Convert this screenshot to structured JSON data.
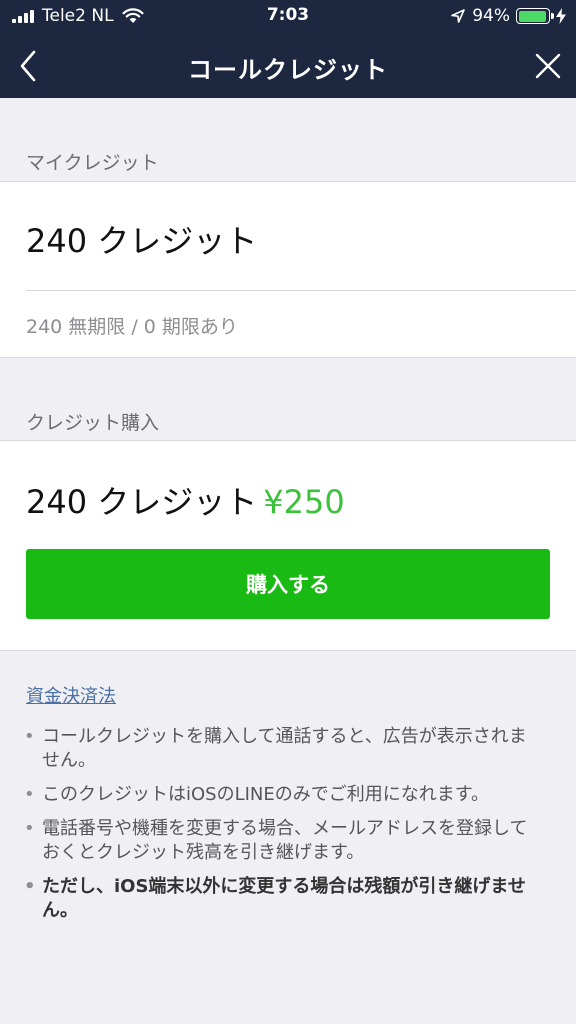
{
  "status_bar": {
    "carrier": "Tele2 NL",
    "time": "7:03",
    "battery_percent": "94%",
    "battery_level": 0.94,
    "icons": [
      "signal-icon",
      "wifi-icon",
      "location-arrow-icon",
      "battery-icon",
      "charging-bolt-icon"
    ]
  },
  "nav": {
    "title": "コールクレジット",
    "back_icon": "chevron-left-icon",
    "close_icon": "close-icon"
  },
  "my_credit": {
    "label": "マイクレジット",
    "value": "240 クレジット",
    "detail": "240 無期限 / 0 期限あり"
  },
  "purchase": {
    "label": "クレジット購入",
    "credit_amount": "240 クレジット",
    "price": "¥250",
    "button_label": "購入する"
  },
  "info": {
    "law_link": "資金決済法",
    "notes": [
      "コールクレジットを購入して通話すると、広告が表示されません。",
      "このクレジットはiOSのLINEのみでご利用になれます。",
      "電話番号や機種を変更する場合、メールアドレスを登録しておくとクレジット残高を引き継げます。",
      "ただし、iOS端末以外に変更する場合は残額が引き継げません。"
    ]
  },
  "colors": {
    "header_bg": "#1d2740",
    "page_bg": "#efeff4",
    "accent_green": "#1aba14",
    "price_green": "#3cc13b",
    "link_blue": "#4a6fa5",
    "battery_green": "#4cd964"
  }
}
